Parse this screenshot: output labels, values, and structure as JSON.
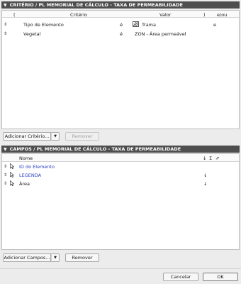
{
  "criteria": {
    "header_title": "CRITÉRIO / PL MEMORIAL DE CÁLCULO - TAXA DE PERMEABILIDADE",
    "columns": {
      "open_paren": "(",
      "criterion": "Critério",
      "value": "Valor",
      "close_paren": ")",
      "and_or": "e/ou"
    },
    "rows": [
      {
        "criterion": "Tipo de Elemento",
        "operator": "é",
        "value": "Trama",
        "and_or": "e"
      },
      {
        "criterion": "Vegetal",
        "operator": "é",
        "value": "ZON - Área permeável",
        "and_or": ""
      }
    ],
    "add_button": "Adicionar Critério...",
    "remove_button": "Remover"
  },
  "fields": {
    "header_title": "CAMPOS / PL MEMORIAL DE CÁLCULO - TAXA DE PERMEABILIDADE",
    "columns": {
      "name": "Nome",
      "sort_symbol": "↓",
      "sum_symbol": "Σ",
      "pin_symbol": "⇗"
    },
    "rows": [
      {
        "name": "ID do Elemento",
        "sort": ""
      },
      {
        "name": "LEGENDA",
        "sort": "↓"
      },
      {
        "name": "Área",
        "sort": "↓"
      }
    ],
    "add_button": "Adicionar Campos...",
    "remove_button": "Remover"
  },
  "footer": {
    "cancel": "Cancelar",
    "ok": "OK"
  },
  "colors": {
    "header_bg": "#4e4e4e",
    "link_blue": "#2a3fc2"
  }
}
